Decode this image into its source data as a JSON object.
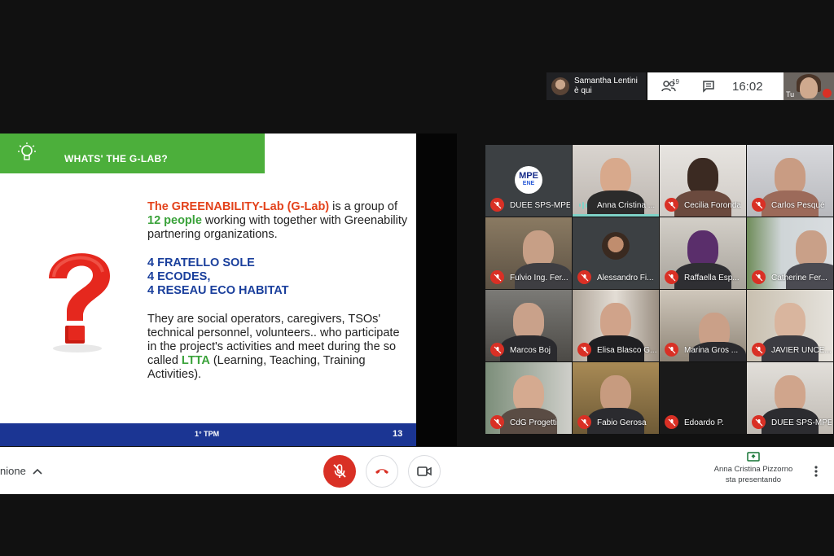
{
  "notification": {
    "line1": "Samantha Lentini",
    "line2": "è qui"
  },
  "toolbar": {
    "participants_count": "19",
    "clock": "16:02",
    "self_label": "Tu"
  },
  "slide": {
    "title": "WHATS' THE G-LAB?",
    "para1": {
      "r1": "The GREENABILITY-Lab (G-Lab)",
      "t1": " is a group of ",
      "g1": "12 people",
      "t2": " working with together with Greenability partnering organizations."
    },
    "list": [
      "4 FRATELLO SOLE",
      "4 ECODES,",
      "4 RESEAU ECO HABITAT"
    ],
    "para3": {
      "t1": "They are social operators, caregivers, TSOs' technical personnel, volunteers.. who participate in the project's activities and meet during the so called ",
      "g1": "LTTA",
      "t2": " (Learning, Teaching, Training Activities)."
    },
    "footer_label": "1° TPM",
    "page_number": "13"
  },
  "participants": [
    {
      "name": "DUEE SPS-MPE",
      "muted": true
    },
    {
      "name": "Anna Cristina ...",
      "muted": false,
      "speaking": true
    },
    {
      "name": "Cecilia Foronda",
      "muted": true
    },
    {
      "name": "Carlos Pesqué",
      "muted": true
    },
    {
      "name": "Fulvio Ing. Fer...",
      "muted": true
    },
    {
      "name": "Alessandro Fi...",
      "muted": true
    },
    {
      "name": "Raffaella Esp...",
      "muted": true
    },
    {
      "name": "Catherine Fer...",
      "muted": true
    },
    {
      "name": "Marcos Boj",
      "muted": true
    },
    {
      "name": "Elisa Blasco G...",
      "muted": true
    },
    {
      "name": "Marina Gros ...",
      "muted": true
    },
    {
      "name": "JAVIER UNCE...",
      "muted": true
    },
    {
      "name": "CdG Progetti",
      "muted": true
    },
    {
      "name": "Fabio Gerosa",
      "muted": true
    },
    {
      "name": "Edoardo P.",
      "muted": true
    },
    {
      "name": "DUEE SPS-MPE",
      "muted": true
    }
  ],
  "logo_text": {
    "l1": "MPE",
    "l2": "ENE"
  },
  "bottombar": {
    "meeting_details_label": "nione",
    "presenter_line1": "Anna Cristina Pizzorno",
    "presenter_line2": "sta presentando"
  },
  "colors": {
    "accent_red": "#d93025",
    "slide_green": "#4caf3b",
    "slide_blue": "#1b3593",
    "speaking_teal": "#7fd3c8"
  }
}
